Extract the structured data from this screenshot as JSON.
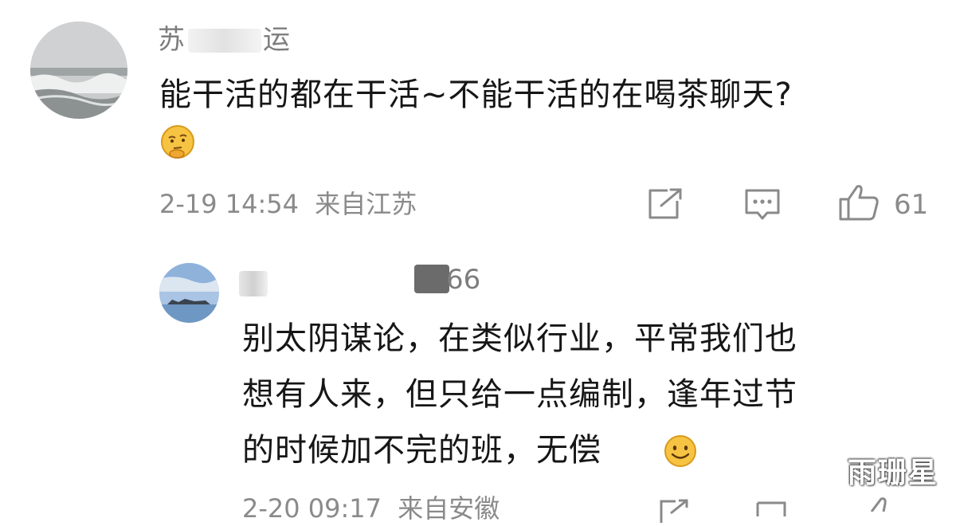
{
  "comment": {
    "username_prefix": "苏",
    "username_suffix": "运",
    "text": "能干活的都在干活~不能干活的在喝茶聊天?",
    "emoji": "thinking-emoji",
    "timestamp": "2-19 14:54",
    "location": "来自江苏",
    "like_count": "61"
  },
  "reply": {
    "username_suffix": "66",
    "lines": [
      "别太阴谋论，在类似行业，平常我们也",
      "想有人来，但只给一点编制，逢年过节",
      "的时候加不完的班，无偿"
    ],
    "emoji": "smile-emoji",
    "timestamp_partial": "2-20 09:17",
    "location_partial": "来自安徽"
  },
  "watermark": "雨珊星",
  "icons": [
    "share-icon",
    "comment-icon",
    "like-icon"
  ],
  "colors": {
    "meta_gray": "#8a8a8a",
    "text": "#161616",
    "emoji_yellow": "#f6c343"
  }
}
